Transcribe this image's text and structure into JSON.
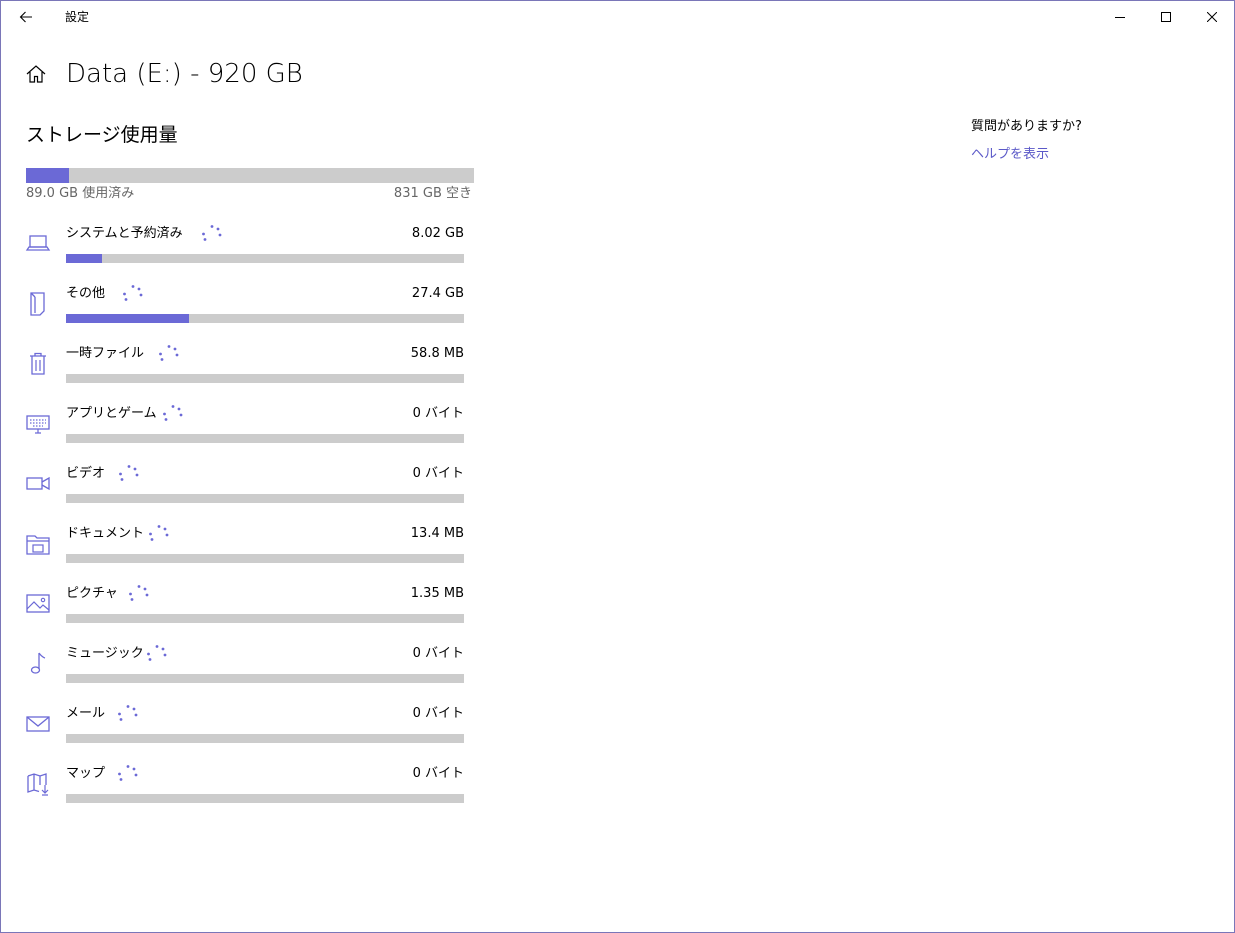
{
  "window": {
    "app_title": "設定"
  },
  "header": {
    "title": "Data (E:) - 920 GB"
  },
  "storage": {
    "section_title": "ストレージ使用量",
    "used_label": "89.0 GB 使用済み",
    "free_label": "831 GB 空き",
    "used_fraction": 0.0967
  },
  "categories": [
    {
      "icon": "laptop-icon",
      "name": "システムと予約済み",
      "size": "8.02 GB",
      "fraction": 0.0902
    },
    {
      "icon": "document-other-icon",
      "name": "その他",
      "size": "27.4 GB",
      "fraction": 0.3082
    },
    {
      "icon": "trash-icon",
      "name": "一時ファイル",
      "size": "58.8 MB",
      "fraction": 0.0
    },
    {
      "icon": "keyboard-icon",
      "name": "アプリとゲーム",
      "size": "0 バイト",
      "fraction": 0.0
    },
    {
      "icon": "video-camera-icon",
      "name": "ビデオ",
      "size": "0 バイト",
      "fraction": 0.0
    },
    {
      "icon": "folder-documents-icon",
      "name": "ドキュメント",
      "size": "13.4 MB",
      "fraction": 0.0
    },
    {
      "icon": "picture-icon",
      "name": "ピクチャ",
      "size": "1.35 MB",
      "fraction": 0.0
    },
    {
      "icon": "music-note-icon",
      "name": "ミュージック",
      "size": "0 バイト",
      "fraction": 0.0
    },
    {
      "icon": "mail-icon",
      "name": "メール",
      "size": "0 バイト",
      "fraction": 0.0
    },
    {
      "icon": "map-download-icon",
      "name": "マップ",
      "size": "0 バイト",
      "fraction": 0.0
    }
  ],
  "help": {
    "question": "質問がありますか?",
    "link": "ヘルプを表示"
  },
  "colors": {
    "accent": "#6b69d6",
    "bar_track": "#cccccc",
    "link": "#5b59c8",
    "window_border": "#7a76b8"
  }
}
